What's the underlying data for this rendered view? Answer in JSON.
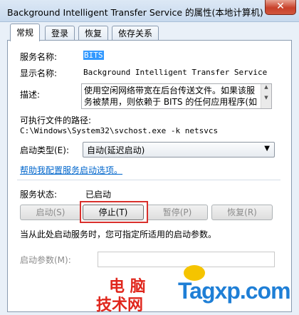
{
  "window": {
    "title": "Background Intelligent Transfer Service 的属性(本地计算机)",
    "close_glyph": "✕"
  },
  "tabs": [
    {
      "label": "常规",
      "active": true
    },
    {
      "label": "登录",
      "active": false
    },
    {
      "label": "恢复",
      "active": false
    },
    {
      "label": "依存关系",
      "active": false
    }
  ],
  "general": {
    "service_name_label": "服务名称:",
    "service_name_value": "BITS",
    "display_name_label": "显示名称:",
    "display_name_value": "Background Intelligent Transfer Service",
    "description_label": "描述:",
    "description_line1": "使用空闲网络带宽在后台传送文件。如果该服",
    "description_line2": "务被禁用，则依赖于 BITS 的任何应用程序(如",
    "exe_path_label": "可执行文件的路径:",
    "exe_path_value": "C:\\Windows\\System32\\svchost.exe -k netsvcs",
    "startup_type_label": "启动类型(E):",
    "startup_type_value": "自动(延迟启动)",
    "help_link": "帮助我配置服务启动选项。",
    "status_label": "服务状态:",
    "status_value": "已启动",
    "buttons": {
      "start": "启动(S)",
      "stop": "停止(T)",
      "pause": "暂停(P)",
      "resume": "恢复(R)"
    },
    "hint": "当从此处启动服务时，您可指定所适用的启动参数。",
    "start_params_label": "启动参数(M):",
    "start_params_value": ""
  },
  "watermark": {
    "line1": "电 脑",
    "line2": "技术网",
    "site": "Tagxp.com",
    "colors": {
      "red": "#e0261c",
      "blue": "#1f7fd6",
      "yellow": "#f5c400"
    }
  },
  "colors": {
    "highlight": "#d9302c",
    "selection": "#3399ff",
    "link": "#0066cc"
  }
}
